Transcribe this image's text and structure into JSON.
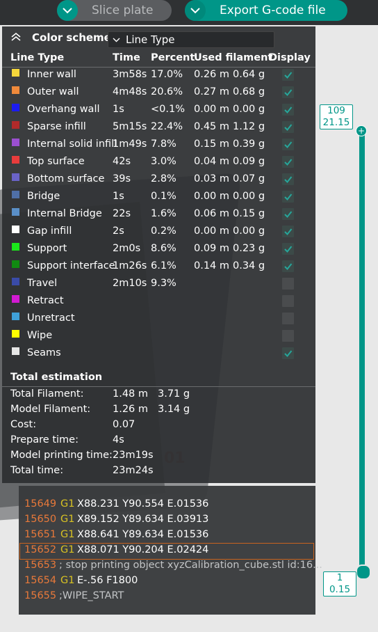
{
  "toolbar": {
    "slice_label": "Slice plate",
    "export_label": "Export G-code file"
  },
  "legend": {
    "scheme_label": "Color scheme",
    "scheme_value": "Line Type",
    "headers": {
      "type": "Line Type",
      "time": "Time",
      "percent": "Percent",
      "used": "Used filament",
      "display": "Display"
    },
    "rows": [
      {
        "name": "Inner wall",
        "color": "#f5d63b",
        "time": "3m58s",
        "percent": "17.0%",
        "m": "0.26 m",
        "g": "0.64 g",
        "display": true
      },
      {
        "name": "Outer wall",
        "color": "#f08a3b",
        "time": "4m48s",
        "percent": "20.6%",
        "m": "0.27 m",
        "g": "0.68 g",
        "display": true
      },
      {
        "name": "Overhang wall",
        "color": "#1c1cf0",
        "time": "1s",
        "percent": "<0.1%",
        "m": "0.00 m",
        "g": "0.00 g",
        "display": true
      },
      {
        "name": "Sparse infill",
        "color": "#b02a2a",
        "time": "5m15s",
        "percent": "22.4%",
        "m": "0.45 m",
        "g": "1.12 g",
        "display": true
      },
      {
        "name": "Internal solid infill",
        "color": "#9b4fd0",
        "time": "1m49s",
        "percent": "7.8%",
        "m": "0.15 m",
        "g": "0.39 g",
        "display": true
      },
      {
        "name": "Top surface",
        "color": "#e83c3c",
        "time": "42s",
        "percent": "3.0%",
        "m": "0.04 m",
        "g": "0.09 g",
        "display": true
      },
      {
        "name": "Bottom surface",
        "color": "#6a63c8",
        "time": "39s",
        "percent": "2.8%",
        "m": "0.03 m",
        "g": "0.07 g",
        "display": true
      },
      {
        "name": "Bridge",
        "color": "#4f6fa8",
        "time": "1s",
        "percent": "0.1%",
        "m": "0.00 m",
        "g": "0.00 g",
        "display": true
      },
      {
        "name": "Internal Bridge",
        "color": "#5a8fc8",
        "time": "22s",
        "percent": "1.6%",
        "m": "0.06 m",
        "g": "0.15 g",
        "display": true
      },
      {
        "name": "Gap infill",
        "color": "#ffffff",
        "time": "2s",
        "percent": "0.2%",
        "m": "0.00 m",
        "g": "0.00 g",
        "display": true
      },
      {
        "name": "Support",
        "color": "#1be81b",
        "time": "2m0s",
        "percent": "8.6%",
        "m": "0.09 m",
        "g": "0.23 g",
        "display": true
      },
      {
        "name": "Support interface",
        "color": "#118a11",
        "time": "1m26s",
        "percent": "6.1%",
        "m": "0.14 m",
        "g": "0.34 g",
        "display": true
      },
      {
        "name": "Travel",
        "color": "#3a4ba8",
        "time": "2m10s",
        "percent": "9.3%",
        "m": "",
        "g": "",
        "display": false
      },
      {
        "name": "Retract",
        "color": "#d21ad2",
        "time": "",
        "percent": "",
        "m": "",
        "g": "",
        "display": false
      },
      {
        "name": "Unretract",
        "color": "#3fa0d8",
        "time": "",
        "percent": "",
        "m": "",
        "g": "",
        "display": false
      },
      {
        "name": "Wipe",
        "color": "#ffff00",
        "time": "",
        "percent": "",
        "m": "",
        "g": "",
        "display": false
      },
      {
        "name": "Seams",
        "color": "#e6e6e6",
        "time": "",
        "percent": "",
        "m": "",
        "g": "",
        "display": true
      }
    ]
  },
  "totals": {
    "title": "Total estimation",
    "rows": [
      {
        "label": "Total Filament:",
        "v1": "1.48 m",
        "v2": "3.71 g"
      },
      {
        "label": "Model Filament:",
        "v1": "1.26 m",
        "v2": "3.14 g"
      },
      {
        "label": "Cost:",
        "v1": "0.07",
        "v2": ""
      },
      {
        "label": "Prepare time:",
        "v1": "4s",
        "v2": ""
      },
      {
        "label": "Model printing time:",
        "v1": "23m19s",
        "v2": ""
      },
      {
        "label": "Total time:",
        "v1": "23m24s",
        "v2": ""
      }
    ]
  },
  "gcode": {
    "lines": [
      {
        "num": "15649",
        "cmd": "G1",
        "args": "X88.231 Y90.554 E.01536",
        "comment": "",
        "selected": false
      },
      {
        "num": "15650",
        "cmd": "G1",
        "args": "X89.152 Y89.634 E.03913",
        "comment": "",
        "selected": false
      },
      {
        "num": "15651",
        "cmd": "G1",
        "args": "X88.641 Y89.634 E.01536",
        "comment": "",
        "selected": false
      },
      {
        "num": "15652",
        "cmd": "G1",
        "args": "X88.071 Y90.204 E.02424",
        "comment": "",
        "selected": true
      },
      {
        "num": "15653",
        "cmd": "",
        "args": "",
        "comment": "; stop printing object xyzCalibration_cube.stl id:16...",
        "selected": false
      },
      {
        "num": "15654",
        "cmd": "G1",
        "args": "E-.56 F1800",
        "comment": "",
        "selected": false
      },
      {
        "num": "15655",
        "cmd": "",
        "args": "",
        "comment": ";WIPE_START",
        "selected": false
      }
    ]
  },
  "layer_slider": {
    "top_layer": "109",
    "top_height": "21.15",
    "bottom_layer": "1",
    "bottom_height": "0.15"
  },
  "viewport": {
    "plate_number": "01"
  },
  "colors": {
    "accent": "#009688",
    "gcode_line_number": "#e8793a",
    "gcode_cmd": "#d8c223"
  }
}
